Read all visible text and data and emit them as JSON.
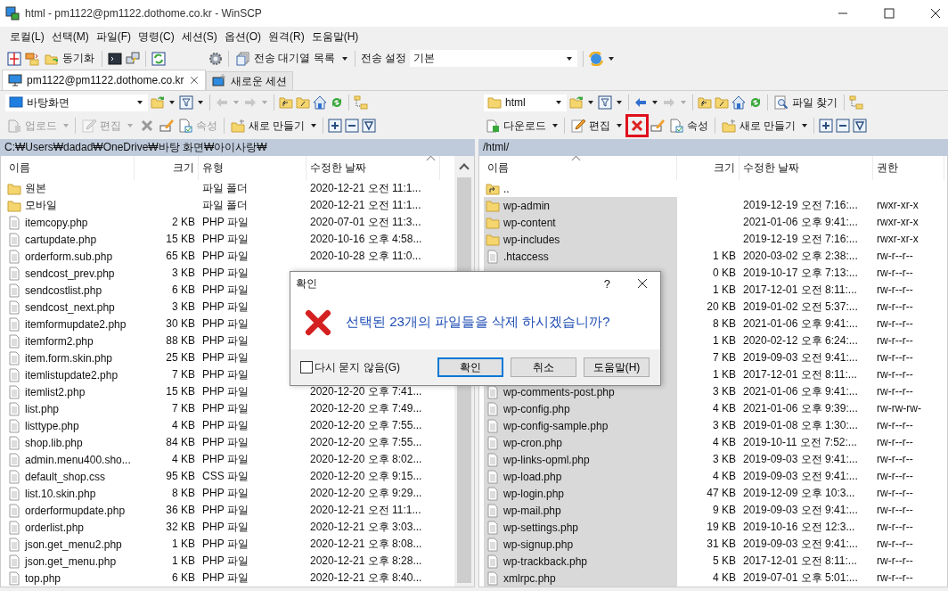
{
  "window": {
    "title": "html - pm1122@pm1122.dothome.co.kr - WinSCP"
  },
  "menu": [
    "로컬(L)",
    "선택(M)",
    "파일(F)",
    "명령(C)",
    "세션(S)",
    "옵션(O)",
    "원격(R)",
    "도움말(H)"
  ],
  "toolbar": {
    "sync_label": "동기화",
    "queue_label": "전송 대기열 목록",
    "transfer_label": "전송 설정",
    "transfer_value": "기본"
  },
  "tabs": [
    {
      "label": "pm1122@pm1122.dothome.co.kr",
      "selected": true,
      "closable": true
    },
    {
      "label": "새로운 세션",
      "selected": false,
      "closable": false
    }
  ],
  "panes": [
    {
      "location": "바탕화면",
      "back_disabled": true,
      "transfer": {
        "kind": "upload",
        "label": "업로드",
        "disabled": true
      },
      "edit": {
        "label": "편집",
        "disabled": true
      },
      "properties": {
        "label": "속성",
        "disabled": true
      },
      "new_label": "새로 만들기",
      "delete_highlighted": false,
      "path": "C:₩Users₩dadad₩OneDrive₩바탕 화면₩아이사랑₩",
      "scrollbar": true,
      "columns": [
        {
          "label": "이름",
          "sorted": false
        },
        {
          "label": "크기",
          "sorted": false
        },
        {
          "label": "유형",
          "sorted": false
        },
        {
          "label": "수정한 날짜",
          "sorted": true
        }
      ],
      "rows": [
        {
          "kind": "folder",
          "selected": false,
          "cells": [
            "원본",
            null,
            "파일 폴더",
            "2020-12-21  오전 11:1..."
          ]
        },
        {
          "kind": "folder",
          "selected": false,
          "cells": [
            "모바일",
            null,
            "파일 폴더",
            "2020-12-21  오전 11:1..."
          ]
        },
        {
          "kind": "file",
          "selected": false,
          "cells": [
            "itemcopy.php",
            "2 KB",
            "PHP 파일",
            "2020-07-01  오전 11:3..."
          ]
        },
        {
          "kind": "file",
          "selected": false,
          "cells": [
            "cartupdate.php",
            "15 KB",
            "PHP 파일",
            "2020-10-16  오후 4:58..."
          ]
        },
        {
          "kind": "file",
          "selected": false,
          "cells": [
            "orderform.sub.php",
            "65 KB",
            "PHP 파일",
            "2020-10-28  오후 11:0..."
          ]
        },
        {
          "kind": "file",
          "selected": false,
          "cells": [
            "sendcost_prev.php",
            "3 KB",
            "PHP 파일",
            null
          ]
        },
        {
          "kind": "file",
          "selected": false,
          "cells": [
            "sendcostlist.php",
            "6 KB",
            "PHP 파일",
            null
          ]
        },
        {
          "kind": "file",
          "selected": false,
          "cells": [
            "sendcost_next.php",
            "3 KB",
            "PHP 파일",
            null
          ]
        },
        {
          "kind": "file",
          "selected": false,
          "cells": [
            "itemformupdate2.php",
            "30 KB",
            "PHP 파일",
            null
          ]
        },
        {
          "kind": "file",
          "selected": false,
          "cells": [
            "itemform2.php",
            "88 KB",
            "PHP 파일",
            null
          ]
        },
        {
          "kind": "file",
          "selected": false,
          "cells": [
            "item.form.skin.php",
            "25 KB",
            "PHP 파일",
            null
          ]
        },
        {
          "kind": "file",
          "selected": false,
          "cells": [
            "itemlistupdate2.php",
            "7 KB",
            "PHP 파일",
            null
          ]
        },
        {
          "kind": "file",
          "selected": false,
          "cells": [
            "itemlist2.php",
            "15 KB",
            "PHP 파일",
            "2020-12-20  오후 7:41..."
          ]
        },
        {
          "kind": "file",
          "selected": false,
          "cells": [
            "list.php",
            "7 KB",
            "PHP 파일",
            "2020-12-20  오후 7:49..."
          ]
        },
        {
          "kind": "file",
          "selected": false,
          "cells": [
            "listtype.php",
            "4 KB",
            "PHP 파일",
            "2020-12-20  오후 7:55..."
          ]
        },
        {
          "kind": "file",
          "selected": false,
          "cells": [
            "shop.lib.php",
            "84 KB",
            "PHP 파일",
            "2020-12-20  오후 7:55..."
          ]
        },
        {
          "kind": "file",
          "selected": false,
          "cells": [
            "admin.menu400.sho...",
            "4 KB",
            "PHP 파일",
            "2020-12-20  오후 8:02..."
          ]
        },
        {
          "kind": "file",
          "selected": false,
          "cells": [
            "default_shop.css",
            "95 KB",
            "CSS 파일",
            "2020-12-20  오후 9:15..."
          ]
        },
        {
          "kind": "file",
          "selected": false,
          "cells": [
            "list.10.skin.php",
            "8 KB",
            "PHP 파일",
            "2020-12-20  오후 9:29..."
          ]
        },
        {
          "kind": "file",
          "selected": false,
          "cells": [
            "orderformupdate.php",
            "36 KB",
            "PHP 파일",
            "2020-12-21  오전 11:1..."
          ]
        },
        {
          "kind": "file",
          "selected": false,
          "cells": [
            "orderlist.php",
            "32 KB",
            "PHP 파일",
            "2020-12-21  오후 3:03..."
          ]
        },
        {
          "kind": "file",
          "selected": false,
          "cells": [
            "json.get_menu2.php",
            "1 KB",
            "PHP 파일",
            "2020-12-21  오후 8:08..."
          ]
        },
        {
          "kind": "file",
          "selected": false,
          "cells": [
            "json.get_menu.php",
            "1 KB",
            "PHP 파일",
            "2020-12-21  오후 8:28..."
          ]
        },
        {
          "kind": "file",
          "selected": false,
          "cells": [
            "top.php",
            "6 KB",
            "PHP 파일",
            "2020-12-21  오후 8:40..."
          ]
        }
      ]
    },
    {
      "location": "html",
      "back_disabled": false,
      "find_label": "파일 찾기",
      "transfer": {
        "kind": "download",
        "label": "다운로드",
        "disabled": false
      },
      "edit": {
        "label": "편집",
        "disabled": false
      },
      "properties": {
        "label": "속성",
        "disabled": false
      },
      "new_label": "새로 만들기",
      "delete_highlighted": true,
      "path": "/html/",
      "scrollbar": false,
      "columns": [
        {
          "label": "이름",
          "sorted": true
        },
        {
          "label": "크기",
          "sorted": false
        },
        {
          "label": "수정한 날짜",
          "sorted": false
        },
        {
          "label": "권한",
          "sorted": false
        }
      ],
      "rows": [
        {
          "kind": "parent",
          "selected": false,
          "cells": [
            "..",
            null,
            null,
            null
          ]
        },
        {
          "kind": "folder",
          "selected": true,
          "cells": [
            "wp-admin",
            null,
            "2019-12-19 오전 7:16:...",
            "rwxr-xr-x"
          ]
        },
        {
          "kind": "folder",
          "selected": true,
          "cells": [
            "wp-content",
            null,
            "2021-01-06 오후 9:41:...",
            "rwxr-xr-x"
          ]
        },
        {
          "kind": "folder",
          "selected": true,
          "cells": [
            "wp-includes",
            null,
            "2019-12-19 오전 7:16:...",
            "rwxr-xr-x"
          ]
        },
        {
          "kind": "file",
          "selected": true,
          "cells": [
            ".htaccess",
            "1 KB",
            "2020-03-02 오후 2:38:...",
            "rw-r--r--"
          ]
        },
        {
          "selected": true,
          "cells": [
            null,
            "0 KB",
            "2019-10-17 오후 7:13:...",
            "rw-r--r--"
          ]
        },
        {
          "selected": true,
          "cells": [
            null,
            "1 KB",
            "2017-12-01 오전 8:11:...",
            "rw-r--r--"
          ]
        },
        {
          "selected": true,
          "cells": [
            null,
            "20 KB",
            "2019-01-02 오전 5:37:...",
            "rw-r--r--"
          ]
        },
        {
          "selected": true,
          "cells": [
            null,
            "8 KB",
            "2021-01-06 오후 9:41:...",
            "rw-r--r--"
          ]
        },
        {
          "selected": true,
          "cells": [
            null,
            "1 KB",
            "2020-02-12 오후 6:24:...",
            "rw-r--r--"
          ]
        },
        {
          "selected": true,
          "cells": [
            null,
            "7 KB",
            "2019-09-03 오전 9:41:...",
            "rw-r--r--"
          ]
        },
        {
          "selected": true,
          "cells": [
            null,
            "1 KB",
            "2017-12-01 오전 8:11:...",
            "rw-r--r--"
          ]
        },
        {
          "kind": "file",
          "selected": true,
          "cells": [
            "wp-comments-post.php",
            "3 KB",
            "2021-01-06 오후 9:41:...",
            "rw-r--r--"
          ]
        },
        {
          "kind": "file",
          "selected": true,
          "cells": [
            "wp-config.php",
            "4 KB",
            "2021-01-06 오후 9:39:...",
            "rw-rw-rw-"
          ]
        },
        {
          "kind": "file",
          "selected": true,
          "cells": [
            "wp-config-sample.php",
            "3 KB",
            "2019-01-08 오후 1:30:...",
            "rw-r--r--"
          ]
        },
        {
          "kind": "file",
          "selected": true,
          "cells": [
            "wp-cron.php",
            "4 KB",
            "2019-10-11 오전 7:52:...",
            "rw-r--r--"
          ]
        },
        {
          "kind": "file",
          "selected": true,
          "cells": [
            "wp-links-opml.php",
            "3 KB",
            "2019-09-03 오전 9:41:...",
            "rw-r--r--"
          ]
        },
        {
          "kind": "file",
          "selected": true,
          "cells": [
            "wp-load.php",
            "4 KB",
            "2019-09-03 오전 9:41:...",
            "rw-r--r--"
          ]
        },
        {
          "kind": "file",
          "selected": true,
          "cells": [
            "wp-login.php",
            "47 KB",
            "2019-12-09 오후 10:3...",
            "rw-r--r--"
          ]
        },
        {
          "kind": "file",
          "selected": true,
          "cells": [
            "wp-mail.php",
            "9 KB",
            "2019-09-03 오전 9:41:...",
            "rw-r--r--"
          ]
        },
        {
          "kind": "file",
          "selected": true,
          "cells": [
            "wp-settings.php",
            "19 KB",
            "2019-10-16 오전 12:3...",
            "rw-r--r--"
          ]
        },
        {
          "kind": "file",
          "selected": true,
          "cells": [
            "wp-signup.php",
            "31 KB",
            "2019-09-03 오전 9:41:...",
            "rw-r--r--"
          ]
        },
        {
          "kind": "file",
          "selected": true,
          "cells": [
            "wp-trackback.php",
            "5 KB",
            "2017-12-01 오전 8:11:...",
            "rw-r--r--"
          ]
        },
        {
          "kind": "file",
          "selected": true,
          "cells": [
            "xmlrpc.php",
            "4 KB",
            "2019-07-01 오후 5:01:...",
            "rw-r--r--"
          ]
        }
      ]
    }
  ],
  "dialog": {
    "title": "확인",
    "help_glyph": "?",
    "message": "선택된 23개의 파일들을 삭제 하시겠습니까?",
    "checkbox": {
      "label": "다시 묻지 않음(G)",
      "checked": false
    },
    "buttons": [
      {
        "label": "확인",
        "default": true
      },
      {
        "label": "취소",
        "default": false
      },
      {
        "label": "도움말(H)",
        "default": false
      }
    ]
  }
}
